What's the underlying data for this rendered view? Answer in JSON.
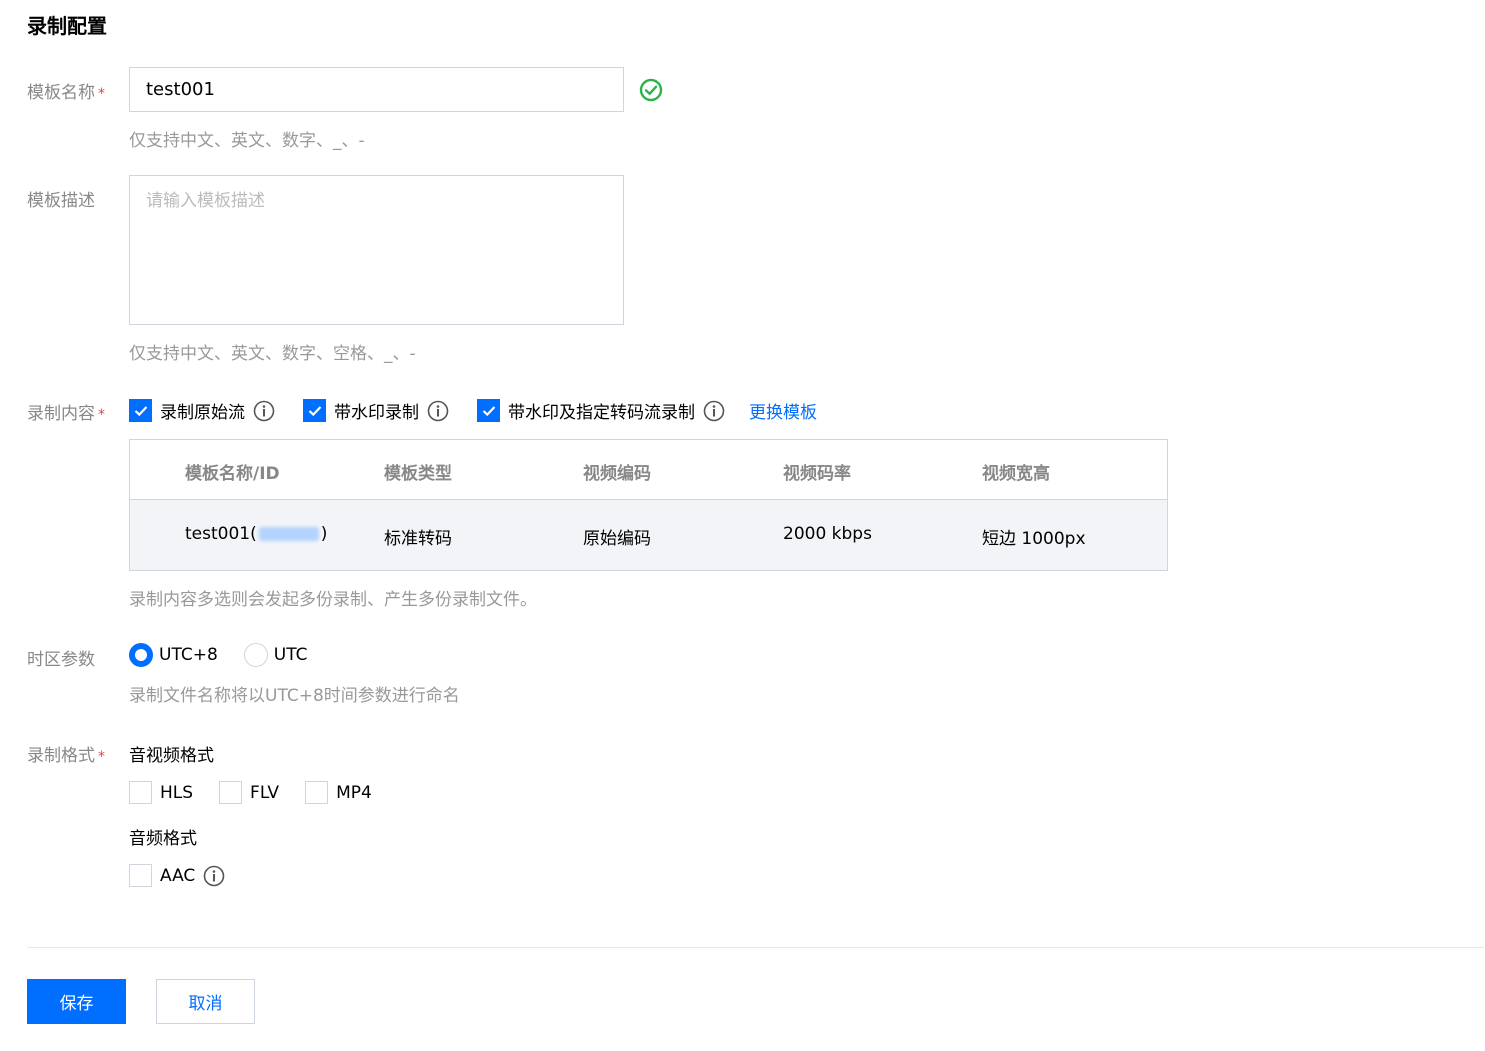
{
  "page": {
    "title": "录制配置"
  },
  "colors": {
    "primary": "#006eff",
    "success": "#29b34a",
    "required": "#e54545"
  },
  "name_field": {
    "label": "模板名称",
    "required_mark": "*",
    "value": "test001",
    "hint": "仅支持中文、英文、数字、_、-",
    "status_icon": "check-circle-icon"
  },
  "desc_field": {
    "label": "模板描述",
    "placeholder": "请输入模板描述",
    "hint": "仅支持中文、英文、数字、空格、_、-"
  },
  "content_field": {
    "label": "录制内容",
    "required_mark": "*",
    "options": [
      {
        "label": "录制原始流",
        "checked": true
      },
      {
        "label": "带水印录制",
        "checked": true
      },
      {
        "label": "带水印及指定转码流录制",
        "checked": true
      }
    ],
    "change_link": "更换模板",
    "hint": "录制内容多选则会发起多份录制、产生多份录制文件。"
  },
  "template_table": {
    "headers": [
      "模板名称/ID",
      "模板类型",
      "视频编码",
      "视频码率",
      "视频宽高"
    ],
    "rows": [
      {
        "name_prefix": "test001(",
        "name_suffix": ")",
        "type": "标准转码",
        "codec": "原始编码",
        "bitrate": "2000 kbps",
        "size": "短边 1000px"
      }
    ]
  },
  "timezone_field": {
    "label": "时区参数",
    "options": [
      {
        "label": "UTC+8",
        "checked": true
      },
      {
        "label": "UTC",
        "checked": false
      }
    ],
    "hint": "录制文件名称将以UTC+8时间参数进行命名"
  },
  "format_field": {
    "label": "录制格式",
    "required_mark": "*",
    "av_title": "音视频格式",
    "av_options": [
      {
        "label": "HLS",
        "checked": false
      },
      {
        "label": "FLV",
        "checked": false
      },
      {
        "label": "MP4",
        "checked": false
      }
    ],
    "audio_title": "音频格式",
    "audio_options": [
      {
        "label": "AAC",
        "checked": false
      }
    ]
  },
  "actions": {
    "save": "保存",
    "cancel": "取消"
  }
}
